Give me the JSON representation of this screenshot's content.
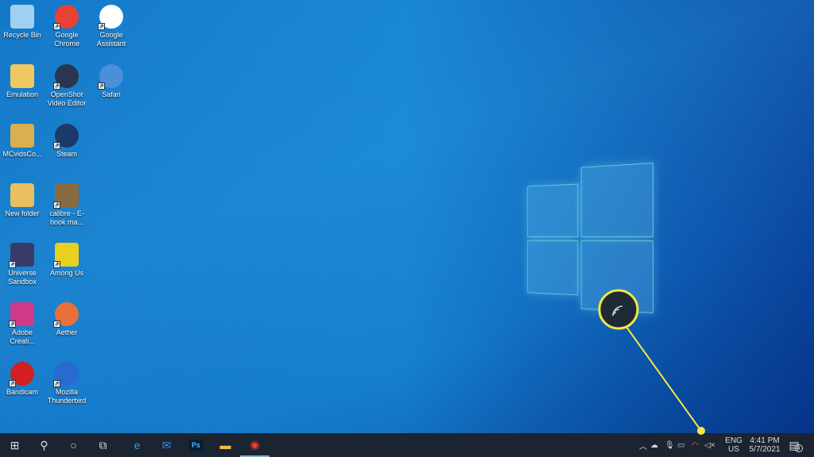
{
  "desktop": {
    "icons": [
      {
        "label": "Recycle Bin",
        "icon": "recycle-bin-icon",
        "color": "#9fd0f0",
        "shortcut": false
      },
      {
        "label": "Google Chrome",
        "icon": "chrome-icon",
        "color": "#e94235",
        "shortcut": true
      },
      {
        "label": "Google Assistant",
        "icon": "google-assistant-icon",
        "color": "#ffffff",
        "shortcut": true
      },
      {
        "label": "Emulation",
        "icon": "folder-icon",
        "color": "#f0c860",
        "shortcut": false
      },
      {
        "label": "OpenShot Video Editor",
        "icon": "openshot-icon",
        "color": "#2a3550",
        "shortcut": true
      },
      {
        "label": "Safari",
        "icon": "safari-icon",
        "color": "#4a8fd8",
        "shortcut": true
      },
      {
        "label": "MCvidsCo...",
        "icon": "folder-icon",
        "color": "#d8b050",
        "shortcut": false
      },
      {
        "label": "Steam",
        "icon": "steam-icon",
        "color": "#1b3a6a",
        "shortcut": true
      },
      null,
      {
        "label": "New folder",
        "icon": "folder-icon",
        "color": "#e8c060",
        "shortcut": false
      },
      {
        "label": "calibre - E-book ma...",
        "icon": "calibre-icon",
        "color": "#8a6a40",
        "shortcut": true
      },
      null,
      {
        "label": "Universe Sandbox",
        "icon": "universe-sandbox-icon",
        "color": "#3a3a6a",
        "shortcut": true
      },
      {
        "label": "Among Us",
        "icon": "among-us-icon",
        "color": "#e8d020",
        "shortcut": true
      },
      null,
      {
        "label": "Adobe Creati...",
        "icon": "adobe-creative-cloud-icon",
        "color": "#d03a8a",
        "shortcut": true
      },
      {
        "label": "Aether",
        "icon": "aether-icon",
        "color": "#e8703a",
        "shortcut": true
      },
      null,
      {
        "label": "Bandicam",
        "icon": "bandicam-icon",
        "color": "#d02020",
        "shortcut": true
      },
      {
        "label": "Mozilla Thunderbird",
        "icon": "thunderbird-icon",
        "color": "#2a6ad0",
        "shortcut": true
      }
    ]
  },
  "taskbar": {
    "apps": [
      {
        "name": "start",
        "icon": "windows-start-icon",
        "glyph": "⊞"
      },
      {
        "name": "search",
        "icon": "search-icon",
        "glyph": "⚲"
      },
      {
        "name": "cortana",
        "icon": "cortana-icon",
        "glyph": "○"
      },
      {
        "name": "task-view",
        "icon": "task-view-icon",
        "glyph": "⧉"
      },
      {
        "name": "edge",
        "icon": "edge-icon",
        "glyph": "e"
      },
      {
        "name": "mail",
        "icon": "mail-icon",
        "glyph": "✉"
      },
      {
        "name": "photoshop",
        "icon": "photoshop-icon",
        "glyph": "Ps"
      },
      {
        "name": "file-explorer",
        "icon": "file-explorer-icon",
        "glyph": "▬"
      },
      {
        "name": "chrome",
        "icon": "chrome-icon",
        "glyph": "◉"
      }
    ]
  },
  "tray": {
    "language": "ENG",
    "region": "US",
    "time": "4:41 PM",
    "date": "5/7/2021",
    "notification_count": "4"
  },
  "callout": {
    "icon": "wifi-icon",
    "color": "#f4e83c"
  }
}
